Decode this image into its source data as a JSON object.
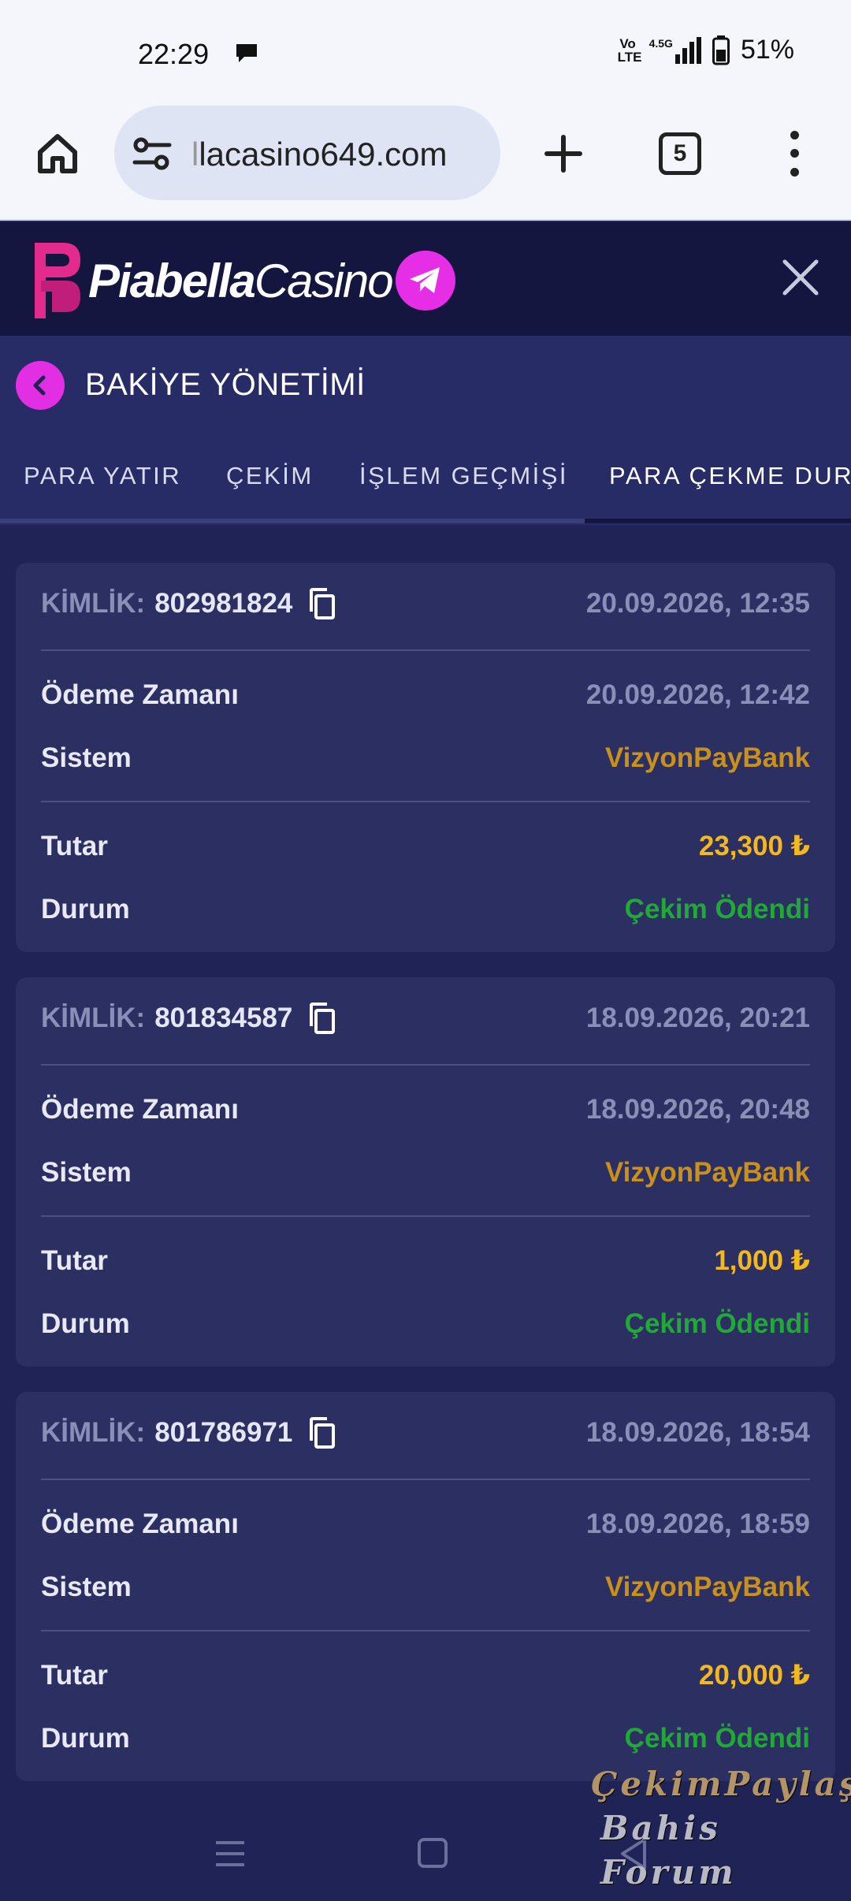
{
  "status_bar": {
    "time": "22:29",
    "volte_line1": "Vo",
    "volte_line2": "LTE",
    "network": "4.5G",
    "battery": "51%"
  },
  "browser": {
    "url_fade": "l",
    "url": "lacasino649.com",
    "tab_count": "5"
  },
  "site": {
    "logo_bold": "Piabella",
    "logo_light": "Casino"
  },
  "page": {
    "title": "BAKİYE YÖNETİMİ"
  },
  "tabs": [
    {
      "label": "PARA YATIR"
    },
    {
      "label": "ÇEKİM"
    },
    {
      "label": "İŞLEM GEÇMİŞİ"
    },
    {
      "label": "PARA ÇEKME DURUMU"
    }
  ],
  "labels": {
    "kimlik": "KİMLİK:",
    "payment_time": "Ödeme Zamanı",
    "system": "Sistem",
    "amount": "Tutar",
    "status": "Durum"
  },
  "withdrawals": [
    {
      "id": "802981824",
      "created": "20.09.2026, 12:35",
      "paid": "20.09.2026, 12:42",
      "system": "VizyonPayBank",
      "amount": "23,300 ₺",
      "status": "Çekim Ödendi"
    },
    {
      "id": "801834587",
      "created": "18.09.2026, 20:21",
      "paid": "18.09.2026, 20:48",
      "system": "VizyonPayBank",
      "amount": "1,000 ₺",
      "status": "Çekim Ödendi"
    },
    {
      "id": "801786971",
      "created": "18.09.2026, 18:54",
      "paid": "18.09.2026, 18:59",
      "system": "VizyonPayBank",
      "amount": "20,000 ₺",
      "status": "Çekim Ödendi"
    }
  ],
  "watermark": {
    "line1": "ÇekimPaylaş",
    "line2": "Bahis Forum"
  },
  "colors": {
    "accent_magenta": "#e32fe3",
    "amount_yellow": "#f2b821",
    "status_green": "#22a838",
    "system_gold": "#c9901a"
  }
}
